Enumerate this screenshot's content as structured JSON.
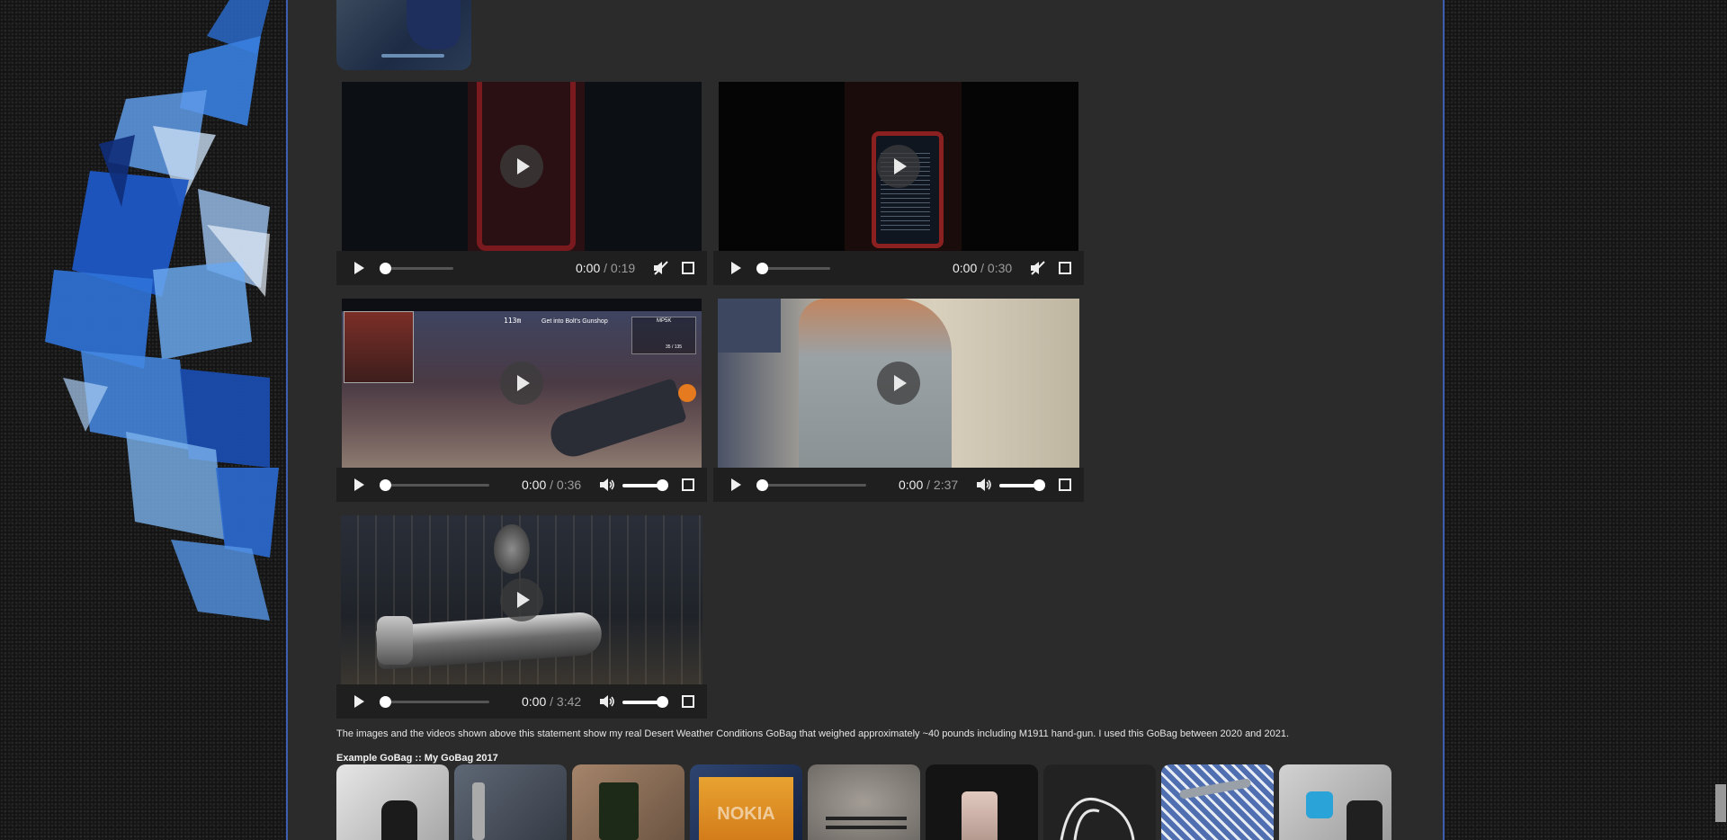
{
  "videos": [
    {
      "current": "0:00",
      "separator": " / ",
      "duration": "0:19",
      "muted": true
    },
    {
      "current": "0:00",
      "separator": " / ",
      "duration": "0:30",
      "muted": true
    },
    {
      "current": "0:00",
      "separator": " / ",
      "duration": "0:36",
      "muted": false
    },
    {
      "current": "0:00",
      "separator": " / ",
      "duration": "2:37",
      "muted": false
    },
    {
      "current": "0:00",
      "separator": " / ",
      "duration": "3:42",
      "muted": false
    }
  ],
  "game_overlay": {
    "distance": "113m",
    "banner": "Get into Bolt's Gunshop",
    "weapon": "MP5K",
    "ammo": "35 / 135"
  },
  "statement": "The images and the videos shown above this statement show my real Desert Weather Conditions GoBag that weighed approximately ~40 pounds including M1911 hand-gun. I used this GoBag between 2020 and 2021.",
  "gallery": {
    "title": "Example GoBag :: My GoBag 2017",
    "items": [
      {
        "subject": "gloves",
        "bg": "#cfcfcf"
      },
      {
        "subject": "flashlight",
        "bg": "#4c5563"
      },
      {
        "subject": "lighter",
        "bg": "#8c7055"
      },
      {
        "subject": "nokia-box",
        "bg": "#21355c",
        "text": "NOKIA"
      },
      {
        "subject": "pens",
        "bg": "#8f8a85"
      },
      {
        "subject": "phone",
        "bg": "#1a1a1a"
      },
      {
        "subject": "earphones",
        "bg": "#262626"
      },
      {
        "subject": "knife",
        "bg": "#3d5d9c"
      },
      {
        "subject": "pouch",
        "bg": "#b8b8b8"
      }
    ]
  },
  "colors": {
    "page_bg": "#2b2b2b",
    "page_border": "#3c5db0",
    "controls_bg": "#1f1f1f"
  }
}
